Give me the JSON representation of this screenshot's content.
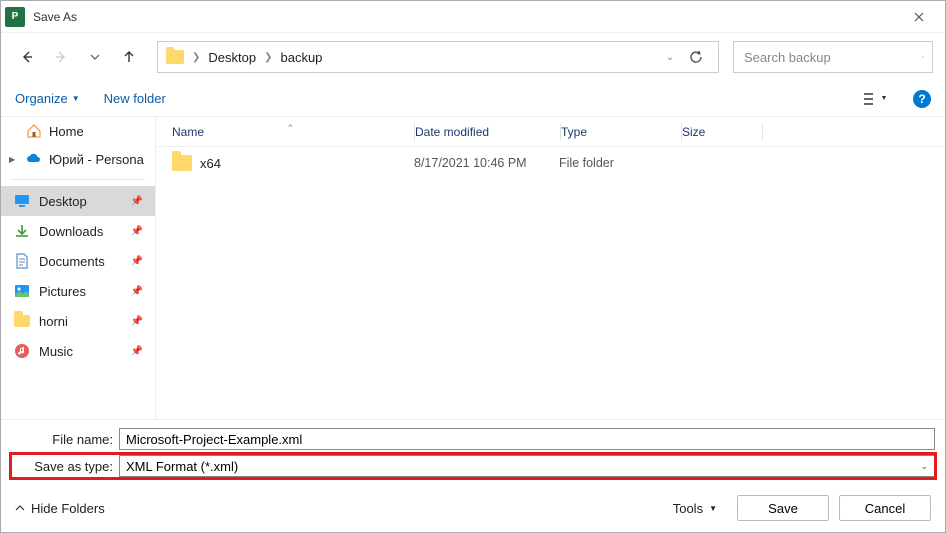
{
  "window": {
    "title": "Save As"
  },
  "breadcrumb": {
    "p0": "Desktop",
    "p1": "backup"
  },
  "search": {
    "placeholder": "Search backup"
  },
  "toolbar": {
    "organize": "Organize",
    "new_folder": "New folder"
  },
  "tree": {
    "home": "Home",
    "cloud": "Юрий - Persona"
  },
  "sidebar": {
    "items": [
      {
        "label": "Desktop"
      },
      {
        "label": "Downloads"
      },
      {
        "label": "Documents"
      },
      {
        "label": "Pictures"
      },
      {
        "label": "horni"
      },
      {
        "label": "Music"
      }
    ]
  },
  "columns": {
    "name": "Name",
    "date": "Date modified",
    "type": "Type",
    "size": "Size"
  },
  "files": [
    {
      "name": "x64",
      "date": "8/17/2021 10:46 PM",
      "type": "File folder"
    }
  ],
  "form": {
    "filename_label": "File name:",
    "filename_value": "Microsoft-Project-Example.xml",
    "savetype_label": "Save as type:",
    "savetype_value": "XML Format (*.xml)"
  },
  "footer": {
    "hide_folders": "Hide Folders",
    "tools": "Tools",
    "save": "Save",
    "cancel": "Cancel"
  }
}
